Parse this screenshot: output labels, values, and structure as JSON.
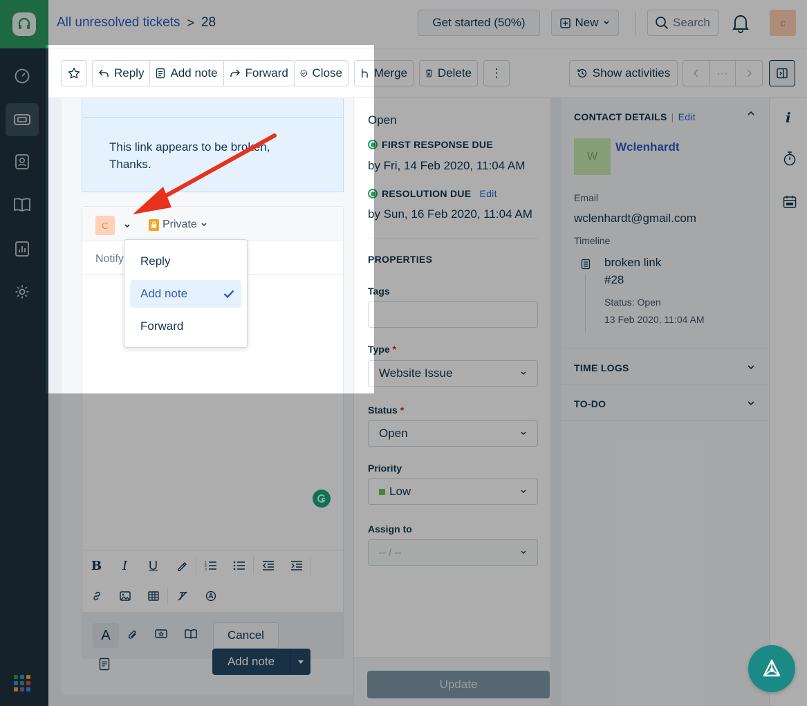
{
  "breadcrumb": {
    "parent": "All unresolved tickets",
    "separator": ">",
    "current": "28"
  },
  "header": {
    "get_started": "Get started (50%)",
    "new": "New",
    "search": "Search",
    "avatar": "c"
  },
  "toolbar": {
    "reply": "Reply",
    "add_note": "Add note",
    "forward": "Forward",
    "close": "Close",
    "merge": "Merge",
    "delete": "Delete",
    "more": "⋮",
    "show_activities": "Show activities",
    "nav_more": "···"
  },
  "message": {
    "line1": "This link appears to be broken,",
    "line2": "Thanks."
  },
  "editor": {
    "avatar": "C",
    "visibility": "Private",
    "notify_placeholder": "Notify",
    "cancel": "Cancel",
    "submit": "Add note"
  },
  "dropdown": {
    "items": [
      {
        "label": "Reply"
      },
      {
        "label": "Add note",
        "selected": true
      },
      {
        "label": "Forward"
      }
    ]
  },
  "ticket": {
    "status": "Open",
    "first_response_label": "FIRST RESPONSE DUE",
    "first_response_value": "by Fri, 14 Feb 2020, 11:04 AM",
    "resolution_label": "RESOLUTION DUE",
    "resolution_edit": "Edit",
    "resolution_value": "by Sun, 16 Feb 2020, 11:04 AM"
  },
  "properties": {
    "heading": "PROPERTIES",
    "tags_label": "Tags",
    "type_label": "Type",
    "type_value": "Website Issue",
    "status_label": "Status",
    "status_value": "Open",
    "priority_label": "Priority",
    "priority_value": "Low",
    "assign_label": "Assign to",
    "assign_value": "-- / --",
    "required_mark": "*",
    "update": "Update"
  },
  "contact": {
    "heading": "CONTACT DETAILS",
    "divider": "|",
    "edit": "Edit",
    "avatar": "W",
    "name": "Wclenhardt",
    "email_label": "Email",
    "email": "wclenhardt@gmail.com",
    "timeline_label": "Timeline",
    "timeline_title": "broken link",
    "timeline_number": "#28",
    "timeline_status": "Status: Open",
    "timeline_date": "13 Feb 2020, 11:04 AM"
  },
  "sections": {
    "time_logs": "TIME LOGS",
    "todo": "TO-DO"
  },
  "colors": {
    "brand_green": "#2c9b60",
    "link_blue": "#2c5cc5",
    "annotation_arrow": "#e8321e",
    "priority_low": "#6ac259"
  }
}
